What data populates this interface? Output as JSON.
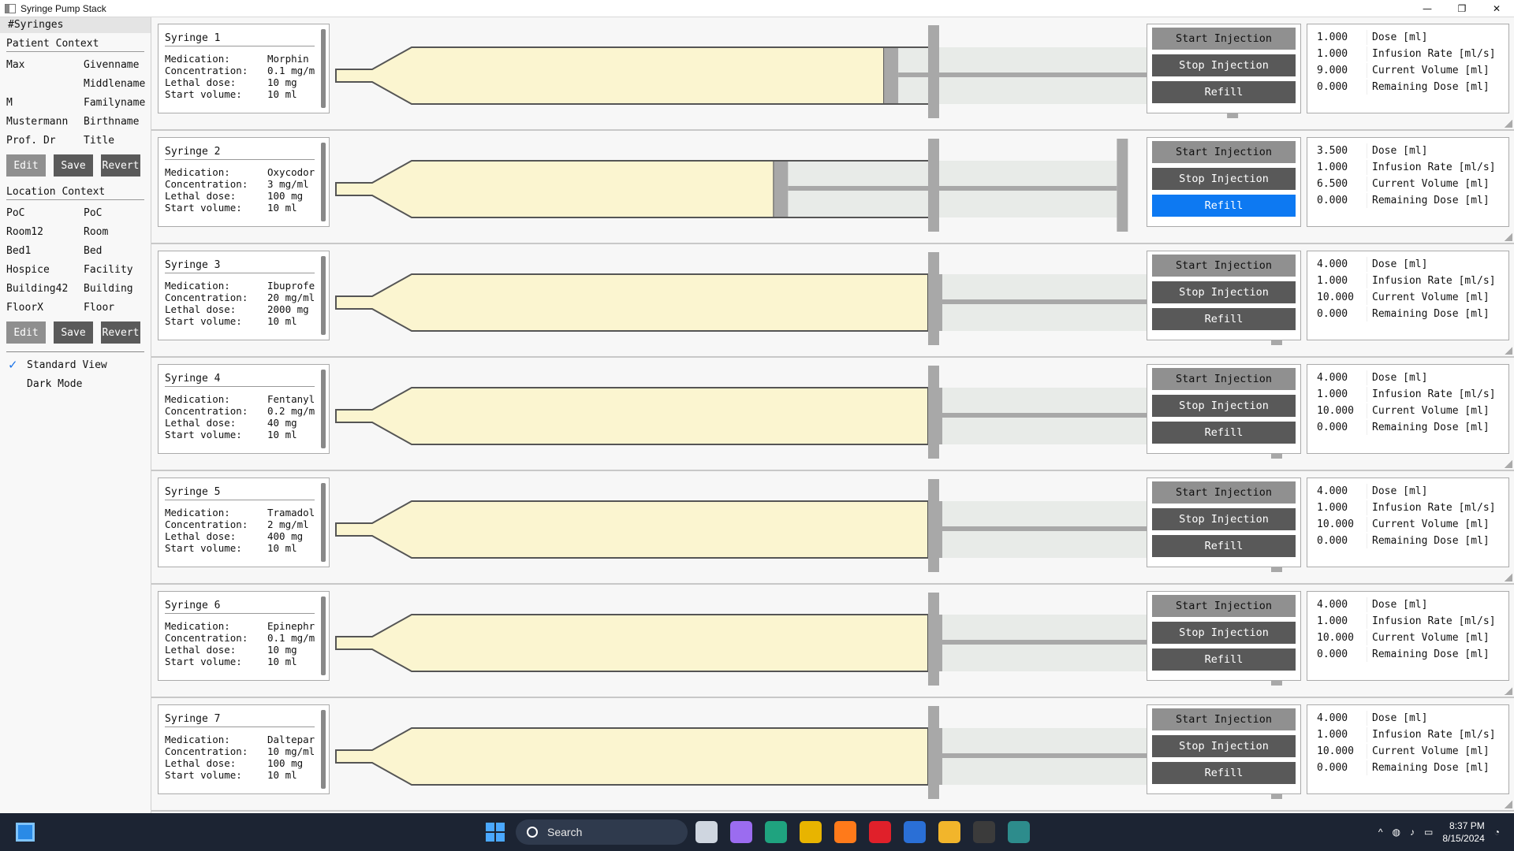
{
  "window": {
    "title": "Syringe Pump Stack",
    "min": "—",
    "max": "❐",
    "close": "✕"
  },
  "sidebar": {
    "header": "#Syringes",
    "patient": {
      "title": "Patient Context",
      "rows": [
        [
          "Max",
          "Givenname"
        ],
        [
          "",
          "Middlename"
        ],
        [
          "M",
          "Familyname"
        ],
        [
          "Mustermann",
          "Birthname"
        ],
        [
          "Prof. Dr",
          "Title"
        ]
      ],
      "edit": "Edit",
      "save": "Save",
      "revert": "Revert"
    },
    "location": {
      "title": "Location Context",
      "rows": [
        [
          "PoC",
          "PoC"
        ],
        [
          "Room12",
          "Room"
        ],
        [
          "Bed1",
          "Bed"
        ],
        [
          "Hospice",
          "Facility"
        ],
        [
          "Building42",
          "Building"
        ],
        [
          "FloorX",
          "Floor"
        ]
      ],
      "edit": "Edit",
      "save": "Save",
      "revert": "Revert"
    },
    "options": {
      "standard_view": "Standard View",
      "dark_mode": "Dark Mode",
      "standard_checked": "✓"
    }
  },
  "labels": {
    "medication": "Medication:",
    "concentration": "Concentration:",
    "lethal": "Lethal dose:",
    "start_volume": "Start volume:",
    "start": "Start Injection",
    "stop": "Stop Injection",
    "refill": "Refill",
    "dose": "Dose [ml]",
    "rate": "Infusion Rate [ml/s]",
    "current": "Current Volume [ml]",
    "remaining": "Remaining Dose [ml]"
  },
  "syringes": [
    {
      "name": "Syringe 1",
      "medication": "Morphin",
      "concentration": "0.1 mg/m",
      "lethal": "10 mg",
      "start_volume": "10 ml",
      "dose": "1.000",
      "rate": "1.000",
      "current": "9.000",
      "remaining": "0.000",
      "fill": 0.9,
      "refill_active": false
    },
    {
      "name": "Syringe 2",
      "medication": "Oxycodor",
      "concentration": "3 mg/ml",
      "lethal": "100 mg",
      "start_volume": "10 ml",
      "dose": "3.500",
      "rate": "1.000",
      "current": "6.500",
      "remaining": "0.000",
      "fill": 0.65,
      "refill_active": true
    },
    {
      "name": "Syringe 3",
      "medication": "Ibuprofe",
      "concentration": "20 mg/ml",
      "lethal": "2000 mg",
      "start_volume": "10 ml",
      "dose": "4.000",
      "rate": "1.000",
      "current": "10.000",
      "remaining": "0.000",
      "fill": 1.0,
      "refill_active": false
    },
    {
      "name": "Syringe 4",
      "medication": "Fentanyl",
      "concentration": "0.2 mg/m",
      "lethal": "40 mg",
      "start_volume": "10 ml",
      "dose": "4.000",
      "rate": "1.000",
      "current": "10.000",
      "remaining": "0.000",
      "fill": 1.0,
      "refill_active": false
    },
    {
      "name": "Syringe 5",
      "medication": "Tramadol",
      "concentration": "2 mg/ml",
      "lethal": "400 mg",
      "start_volume": "10 ml",
      "dose": "4.000",
      "rate": "1.000",
      "current": "10.000",
      "remaining": "0.000",
      "fill": 1.0,
      "refill_active": false
    },
    {
      "name": "Syringe 6",
      "medication": "Epinephr",
      "concentration": "0.1 mg/m",
      "lethal": "10 mg",
      "start_volume": "10 ml",
      "dose": "4.000",
      "rate": "1.000",
      "current": "10.000",
      "remaining": "0.000",
      "fill": 1.0,
      "refill_active": false
    },
    {
      "name": "Syringe 7",
      "medication": "Daltepar",
      "concentration": "10 mg/ml",
      "lethal": "100 mg",
      "start_volume": "10 ml",
      "dose": "4.000",
      "rate": "1.000",
      "current": "10.000",
      "remaining": "0.000",
      "fill": 1.0,
      "refill_active": false
    }
  ],
  "colors": {
    "liquid": "#fbf5d0",
    "barrel": "#e8ebe8",
    "plunger": "#a8a8a8",
    "outline": "#555555",
    "refill_blue": "#0d79f2"
  },
  "taskbar": {
    "search_placeholder": "Search",
    "time": "8:37 PM",
    "date": "8/15/2024",
    "apps": [
      "task-view-icon",
      "copilot-icon",
      "edge-icon",
      "chrome-icon",
      "firefox-icon",
      "opera-icon",
      "vscode-icon",
      "file-explorer-icon",
      "terminal-icon",
      "syringe-app-icon"
    ]
  }
}
